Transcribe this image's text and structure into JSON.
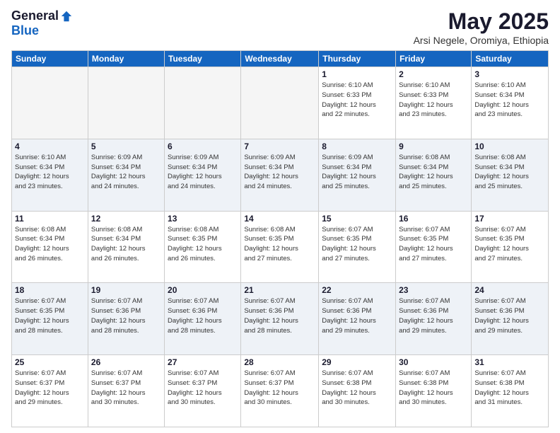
{
  "logo": {
    "general": "General",
    "blue": "Blue"
  },
  "title": "May 2025",
  "subtitle": "Arsi Negele, Oromiya, Ethiopia",
  "days_of_week": [
    "Sunday",
    "Monday",
    "Tuesday",
    "Wednesday",
    "Thursday",
    "Friday",
    "Saturday"
  ],
  "weeks": [
    [
      {
        "day": "",
        "info": ""
      },
      {
        "day": "",
        "info": ""
      },
      {
        "day": "",
        "info": ""
      },
      {
        "day": "",
        "info": ""
      },
      {
        "day": "1",
        "info": "Sunrise: 6:10 AM\nSunset: 6:33 PM\nDaylight: 12 hours\nand 22 minutes."
      },
      {
        "day": "2",
        "info": "Sunrise: 6:10 AM\nSunset: 6:33 PM\nDaylight: 12 hours\nand 23 minutes."
      },
      {
        "day": "3",
        "info": "Sunrise: 6:10 AM\nSunset: 6:34 PM\nDaylight: 12 hours\nand 23 minutes."
      }
    ],
    [
      {
        "day": "4",
        "info": "Sunrise: 6:10 AM\nSunset: 6:34 PM\nDaylight: 12 hours\nand 23 minutes."
      },
      {
        "day": "5",
        "info": "Sunrise: 6:09 AM\nSunset: 6:34 PM\nDaylight: 12 hours\nand 24 minutes."
      },
      {
        "day": "6",
        "info": "Sunrise: 6:09 AM\nSunset: 6:34 PM\nDaylight: 12 hours\nand 24 minutes."
      },
      {
        "day": "7",
        "info": "Sunrise: 6:09 AM\nSunset: 6:34 PM\nDaylight: 12 hours\nand 24 minutes."
      },
      {
        "day": "8",
        "info": "Sunrise: 6:09 AM\nSunset: 6:34 PM\nDaylight: 12 hours\nand 25 minutes."
      },
      {
        "day": "9",
        "info": "Sunrise: 6:08 AM\nSunset: 6:34 PM\nDaylight: 12 hours\nand 25 minutes."
      },
      {
        "day": "10",
        "info": "Sunrise: 6:08 AM\nSunset: 6:34 PM\nDaylight: 12 hours\nand 25 minutes."
      }
    ],
    [
      {
        "day": "11",
        "info": "Sunrise: 6:08 AM\nSunset: 6:34 PM\nDaylight: 12 hours\nand 26 minutes."
      },
      {
        "day": "12",
        "info": "Sunrise: 6:08 AM\nSunset: 6:34 PM\nDaylight: 12 hours\nand 26 minutes."
      },
      {
        "day": "13",
        "info": "Sunrise: 6:08 AM\nSunset: 6:35 PM\nDaylight: 12 hours\nand 26 minutes."
      },
      {
        "day": "14",
        "info": "Sunrise: 6:08 AM\nSunset: 6:35 PM\nDaylight: 12 hours\nand 27 minutes."
      },
      {
        "day": "15",
        "info": "Sunrise: 6:07 AM\nSunset: 6:35 PM\nDaylight: 12 hours\nand 27 minutes."
      },
      {
        "day": "16",
        "info": "Sunrise: 6:07 AM\nSunset: 6:35 PM\nDaylight: 12 hours\nand 27 minutes."
      },
      {
        "day": "17",
        "info": "Sunrise: 6:07 AM\nSunset: 6:35 PM\nDaylight: 12 hours\nand 27 minutes."
      }
    ],
    [
      {
        "day": "18",
        "info": "Sunrise: 6:07 AM\nSunset: 6:35 PM\nDaylight: 12 hours\nand 28 minutes."
      },
      {
        "day": "19",
        "info": "Sunrise: 6:07 AM\nSunset: 6:36 PM\nDaylight: 12 hours\nand 28 minutes."
      },
      {
        "day": "20",
        "info": "Sunrise: 6:07 AM\nSunset: 6:36 PM\nDaylight: 12 hours\nand 28 minutes."
      },
      {
        "day": "21",
        "info": "Sunrise: 6:07 AM\nSunset: 6:36 PM\nDaylight: 12 hours\nand 28 minutes."
      },
      {
        "day": "22",
        "info": "Sunrise: 6:07 AM\nSunset: 6:36 PM\nDaylight: 12 hours\nand 29 minutes."
      },
      {
        "day": "23",
        "info": "Sunrise: 6:07 AM\nSunset: 6:36 PM\nDaylight: 12 hours\nand 29 minutes."
      },
      {
        "day": "24",
        "info": "Sunrise: 6:07 AM\nSunset: 6:36 PM\nDaylight: 12 hours\nand 29 minutes."
      }
    ],
    [
      {
        "day": "25",
        "info": "Sunrise: 6:07 AM\nSunset: 6:37 PM\nDaylight: 12 hours\nand 29 minutes."
      },
      {
        "day": "26",
        "info": "Sunrise: 6:07 AM\nSunset: 6:37 PM\nDaylight: 12 hours\nand 30 minutes."
      },
      {
        "day": "27",
        "info": "Sunrise: 6:07 AM\nSunset: 6:37 PM\nDaylight: 12 hours\nand 30 minutes."
      },
      {
        "day": "28",
        "info": "Sunrise: 6:07 AM\nSunset: 6:37 PM\nDaylight: 12 hours\nand 30 minutes."
      },
      {
        "day": "29",
        "info": "Sunrise: 6:07 AM\nSunset: 6:38 PM\nDaylight: 12 hours\nand 30 minutes."
      },
      {
        "day": "30",
        "info": "Sunrise: 6:07 AM\nSunset: 6:38 PM\nDaylight: 12 hours\nand 30 minutes."
      },
      {
        "day": "31",
        "info": "Sunrise: 6:07 AM\nSunset: 6:38 PM\nDaylight: 12 hours\nand 31 minutes."
      }
    ]
  ]
}
